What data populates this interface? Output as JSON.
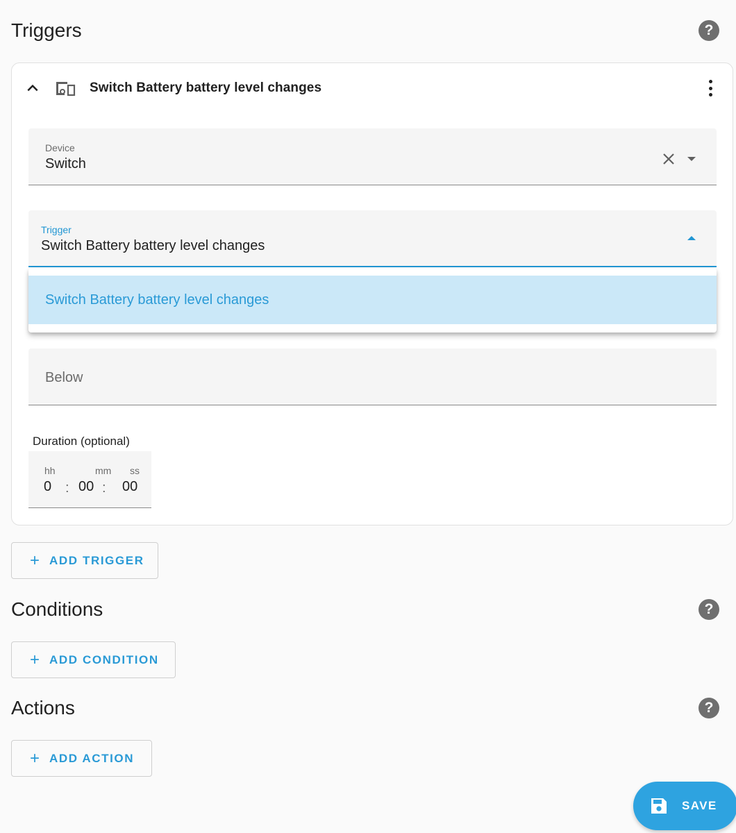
{
  "sections": {
    "triggers": {
      "title": "Triggers"
    },
    "conditions": {
      "title": "Conditions"
    },
    "actions": {
      "title": "Actions"
    }
  },
  "trigger_card": {
    "title": "Switch Battery battery level changes",
    "device_field": {
      "label": "Device",
      "value": "Switch"
    },
    "trigger_field": {
      "label": "Trigger",
      "value": "Switch Battery battery level changes"
    },
    "menu_options": [
      {
        "label": "Switch Battery battery level changes",
        "selected": true
      }
    ],
    "below_field": {
      "placeholder": "Below"
    },
    "duration": {
      "label": "Duration (optional)",
      "units": {
        "hours": "hh",
        "minutes": "mm",
        "seconds": "ss"
      },
      "values": {
        "hours": "0",
        "minutes": "00",
        "seconds": "00"
      },
      "separator": ":"
    }
  },
  "buttons": {
    "add_trigger": "ADD TRIGGER",
    "add_condition": "ADD CONDITION",
    "add_action": "ADD ACTION",
    "save": "SAVE",
    "plus": "+"
  },
  "help_icon_glyph": "?",
  "colors": {
    "accent": "#2196d3",
    "fab": "#2ea3e0",
    "selected_option_bg": "#cbe8f8",
    "help_icon": "#6f6f6f"
  },
  "icons": {
    "collapse": "chevron-up-icon",
    "device": "devices-icon",
    "menu": "dots-vertical-icon",
    "clear": "close-icon",
    "help": "help-circle-icon",
    "save": "content-save-icon"
  }
}
